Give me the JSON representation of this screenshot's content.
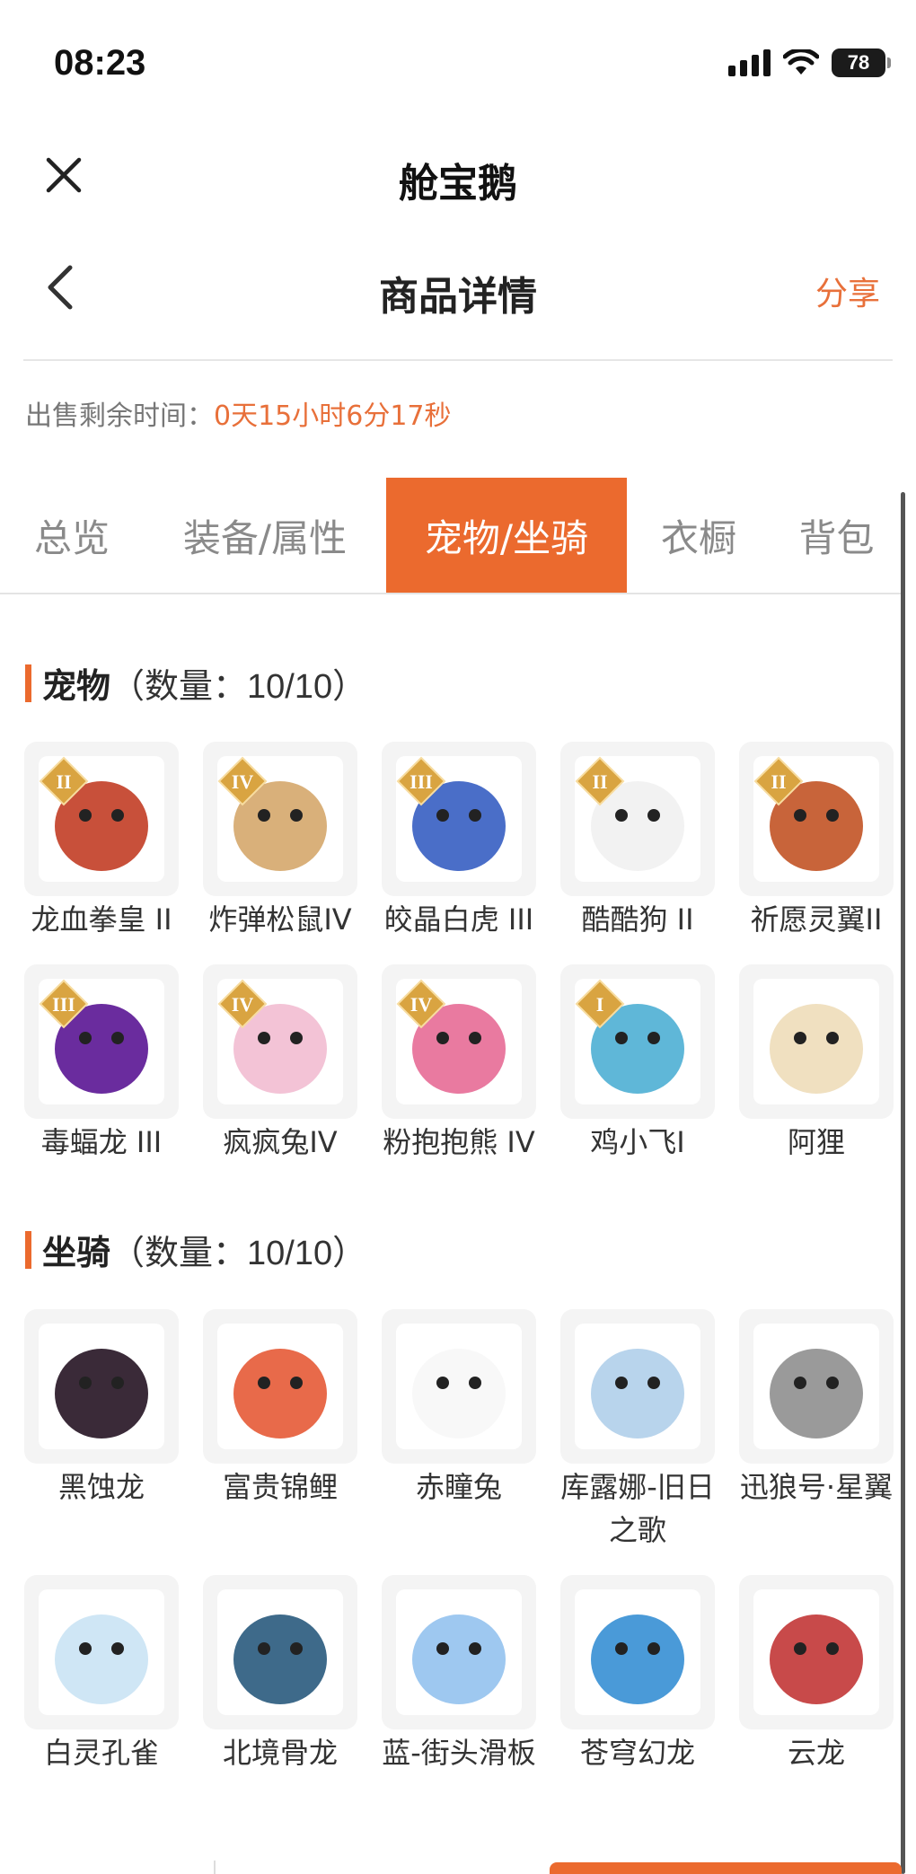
{
  "status_bar": {
    "time": "08:23",
    "battery": "78"
  },
  "app": {
    "title": "舱宝鹅"
  },
  "nav": {
    "title": "商品详情",
    "share_label": "分享"
  },
  "countdown": {
    "label": "出售剩余时间：",
    "value": "0天15小时6分17秒"
  },
  "tabs": [
    {
      "label": "总览",
      "active": false
    },
    {
      "label": "装备/属性",
      "active": false
    },
    {
      "label": "宠物/坐骑",
      "active": true
    },
    {
      "label": "衣橱",
      "active": false
    },
    {
      "label": "背包",
      "active": false
    }
  ],
  "pets": {
    "title": "宠物",
    "count": "（数量：10/10）",
    "items": [
      {
        "name": "龙血拳皇 II",
        "grade": "II",
        "icon": "red-dragon-boxer",
        "color": "#c8503a"
      },
      {
        "name": "炸弹松鼠IV",
        "grade": "IV",
        "icon": "squirrel",
        "color": "#d9b07a"
      },
      {
        "name": "皎晶白虎 III",
        "grade": "III",
        "icon": "white-tiger",
        "color": "#4a6ec8"
      },
      {
        "name": "酷酷狗 II",
        "grade": "II",
        "icon": "white-dog",
        "color": "#f2f2f2"
      },
      {
        "name": "祈愿灵翼II",
        "grade": "II",
        "icon": "eagle",
        "color": "#c8643a"
      },
      {
        "name": "毒蝠龙 III",
        "grade": "III",
        "icon": "purple-dragon",
        "color": "#6a2c9e"
      },
      {
        "name": "疯疯兔IV",
        "grade": "IV",
        "icon": "pink-rabbit",
        "color": "#f3c3d6"
      },
      {
        "name": "粉抱抱熊 IV",
        "grade": "IV",
        "icon": "pink-bear",
        "color": "#e97aa0"
      },
      {
        "name": "鸡小飞I",
        "grade": "I",
        "icon": "blue-chick",
        "color": "#5fb7d8"
      },
      {
        "name": "阿狸",
        "grade": "",
        "icon": "fox-lion-dance",
        "color": "#f0e0c0"
      }
    ]
  },
  "mounts": {
    "title": "坐骑",
    "count": "（数量：10/10）",
    "items": [
      {
        "name": "黑蚀龙",
        "icon": "black-dragon",
        "color": "#3a2a38"
      },
      {
        "name": "富贵锦鲤",
        "icon": "koi",
        "color": "#e86a4a"
      },
      {
        "name": "赤瞳兔",
        "icon": "white-rabbit",
        "color": "#f8f8f8"
      },
      {
        "name": "库露娜-旧日之歌",
        "icon": "luna-girl",
        "color": "#b8d4ec"
      },
      {
        "name": "迅狼号·星翼",
        "icon": "mech-wolf",
        "color": "#9a9a9a"
      },
      {
        "name": "白灵孔雀",
        "icon": "white-peacock",
        "color": "#cfe6f5"
      },
      {
        "name": "北境骨龙",
        "icon": "bone-dragon",
        "color": "#3e6a8a"
      },
      {
        "name": "蓝-街头滑板",
        "icon": "skateboard",
        "color": "#9ec8f0"
      },
      {
        "name": "苍穹幻龙",
        "icon": "sky-dragon",
        "color": "#4a9ad8"
      },
      {
        "name": "云龙",
        "icon": "cloud-dragon",
        "color": "#c84a4a"
      }
    ]
  },
  "colors": {
    "accent": "#eb6a2e",
    "badge": "#d9a441"
  }
}
